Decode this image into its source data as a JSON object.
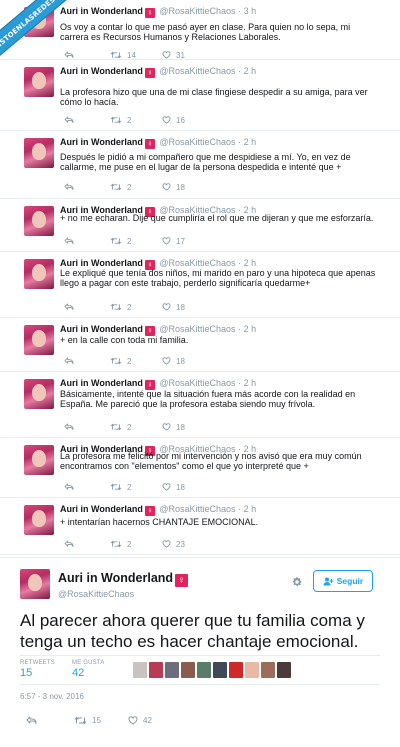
{
  "watermark": "VISTOENLASREDES.COM",
  "thread": [
    {
      "name": "Auri in Wonderland",
      "badge": "♀",
      "handle": "@RosaKittieChaos",
      "dot": "·",
      "time": "3 h",
      "text": "Os voy a contar lo que me pasó ayer en clase. Para quien no lo sepa, mi carrera es Recursos Humanos y Relaciones Laborales.",
      "retweets": "14",
      "likes": "31"
    },
    {
      "name": "Auri in Wonderland",
      "badge": "♀",
      "handle": "@RosaKittieChaos",
      "dot": "·",
      "time": "2 h",
      "text": "La profesora hizo que una de mi clase fingiese despedir a su amiga, para ver cómo lo hacía.",
      "retweets": "2",
      "likes": "16"
    },
    {
      "name": "Auri in Wonderland",
      "badge": "♀",
      "handle": "@RosaKittieChaos",
      "dot": "·",
      "time": "2 h",
      "text": "Después le pidió a mi compañero que me despidiese a mí. Yo, en vez de callarme, me puse en el lugar de la persona despedida e intenté que +",
      "retweets": "2",
      "likes": "18"
    },
    {
      "name": "Auri in Wonderland",
      "badge": "♀",
      "handle": "@RosaKittieChaos",
      "dot": "·",
      "time": "2 h",
      "text": "+ no me echaran. Dije que cumpliría el rol que me dijeran y que me esforzaría.",
      "retweets": "2",
      "likes": "17"
    },
    {
      "name": "Auri in Wonderland",
      "badge": "♀",
      "handle": "@RosaKittieChaos",
      "dot": "·",
      "time": "2 h",
      "text": "Le expliqué que tenía dos niños, mi marido en paro y una hipoteca que apenas llego a pagar con este trabajo, perderlo significaría quedarme+",
      "retweets": "2",
      "likes": "18"
    },
    {
      "name": "Auri in Wonderland",
      "badge": "♀",
      "handle": "@RosaKittieChaos",
      "dot": "·",
      "time": "2 h",
      "text": "+ en la calle con toda mi familia.",
      "retweets": "2",
      "likes": "18"
    },
    {
      "name": "Auri in Wonderland",
      "badge": "♀",
      "handle": "@RosaKittieChaos",
      "dot": "·",
      "time": "2 h",
      "text": "Básicamente, intenté que la situación fuera más acorde con la realidad en España. Me pareció que la profesora estaba siendo muy frívola.",
      "retweets": "2",
      "likes": "18"
    },
    {
      "name": "Auri in Wonderland",
      "badge": "♀",
      "handle": "@RosaKittieChaos",
      "dot": "·",
      "time": "2 h",
      "text": "La profesora me felicitó por mi intervención y nos avisó que era muy común encontramos con \"elementos\" como el que yo interpreté que +",
      "retweets": "2",
      "likes": "18"
    },
    {
      "name": "Auri in Wonderland",
      "badge": "♀",
      "handle": "@RosaKittieChaos",
      "dot": "·",
      "time": "2 h",
      "text": "+ intentarían hacernos CHANTAJE EMOCIONAL.",
      "retweets": "2",
      "likes": "23"
    }
  ],
  "focused": {
    "name": "Auri in Wonderland",
    "badge": "♀",
    "handle": "@RosaKittieChaos",
    "follow_label": "Seguir",
    "text": "Al parecer ahora querer que tu familia coma y tenga un techo es hacer chantaje emocional.",
    "retweets_label": "RETWEETS",
    "retweets": "15",
    "likes_label": "ME GUSTA",
    "likes": "42",
    "date": "6:57 - 3 nov. 2016",
    "action_retweets": "15",
    "action_likes": "42"
  },
  "colors": {
    "accent": "#1da1f2",
    "muted": "#8899a6",
    "badge": "#e0245e",
    "divider": "#e6ecf0",
    "watermark": "#2a9bd6"
  },
  "icons": [
    "reply-icon",
    "retweet-icon",
    "like-icon",
    "gear-icon",
    "follow-user-icon"
  ]
}
